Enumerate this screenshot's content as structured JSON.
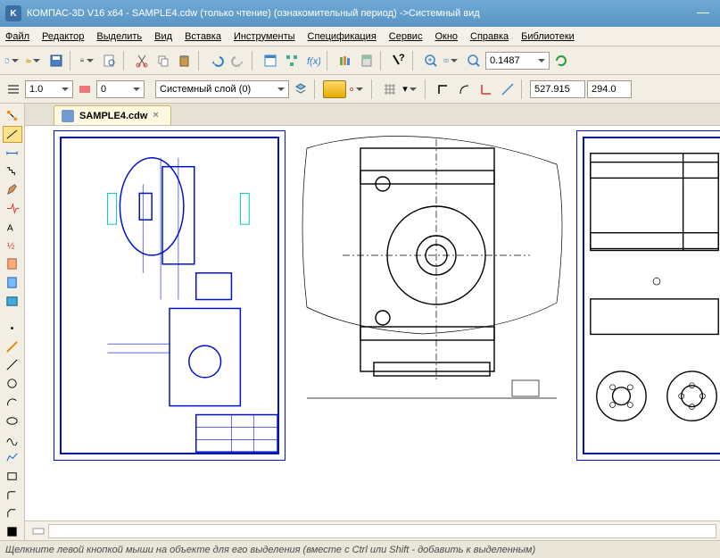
{
  "title": "КОМПАС-3D V16  x64 - SAMPLE4.cdw (только чтение) (ознакомительный период) ->Системный вид",
  "menu": {
    "file": "Файл",
    "edit": "Редактор",
    "select": "Выделить",
    "view": "Вид",
    "insert": "Вставка",
    "tools": "Инструменты",
    "spec": "Спецификация",
    "service": "Сервис",
    "window": "Окно",
    "help": "Справка",
    "libs": "Библиотеки"
  },
  "toolbar2": {
    "style_num": "1.0",
    "style_idx": "0",
    "layer": "Системный слой (0)",
    "zoom": "0.1487",
    "x": "527.915",
    "y": "294.0"
  },
  "tab": {
    "name": "SAMPLE4.cdw"
  },
  "status": "Щелкните левой кнопкой мыши на объекте для его выделения (вместе с Ctrl или Shift - добавить к выделенным)"
}
